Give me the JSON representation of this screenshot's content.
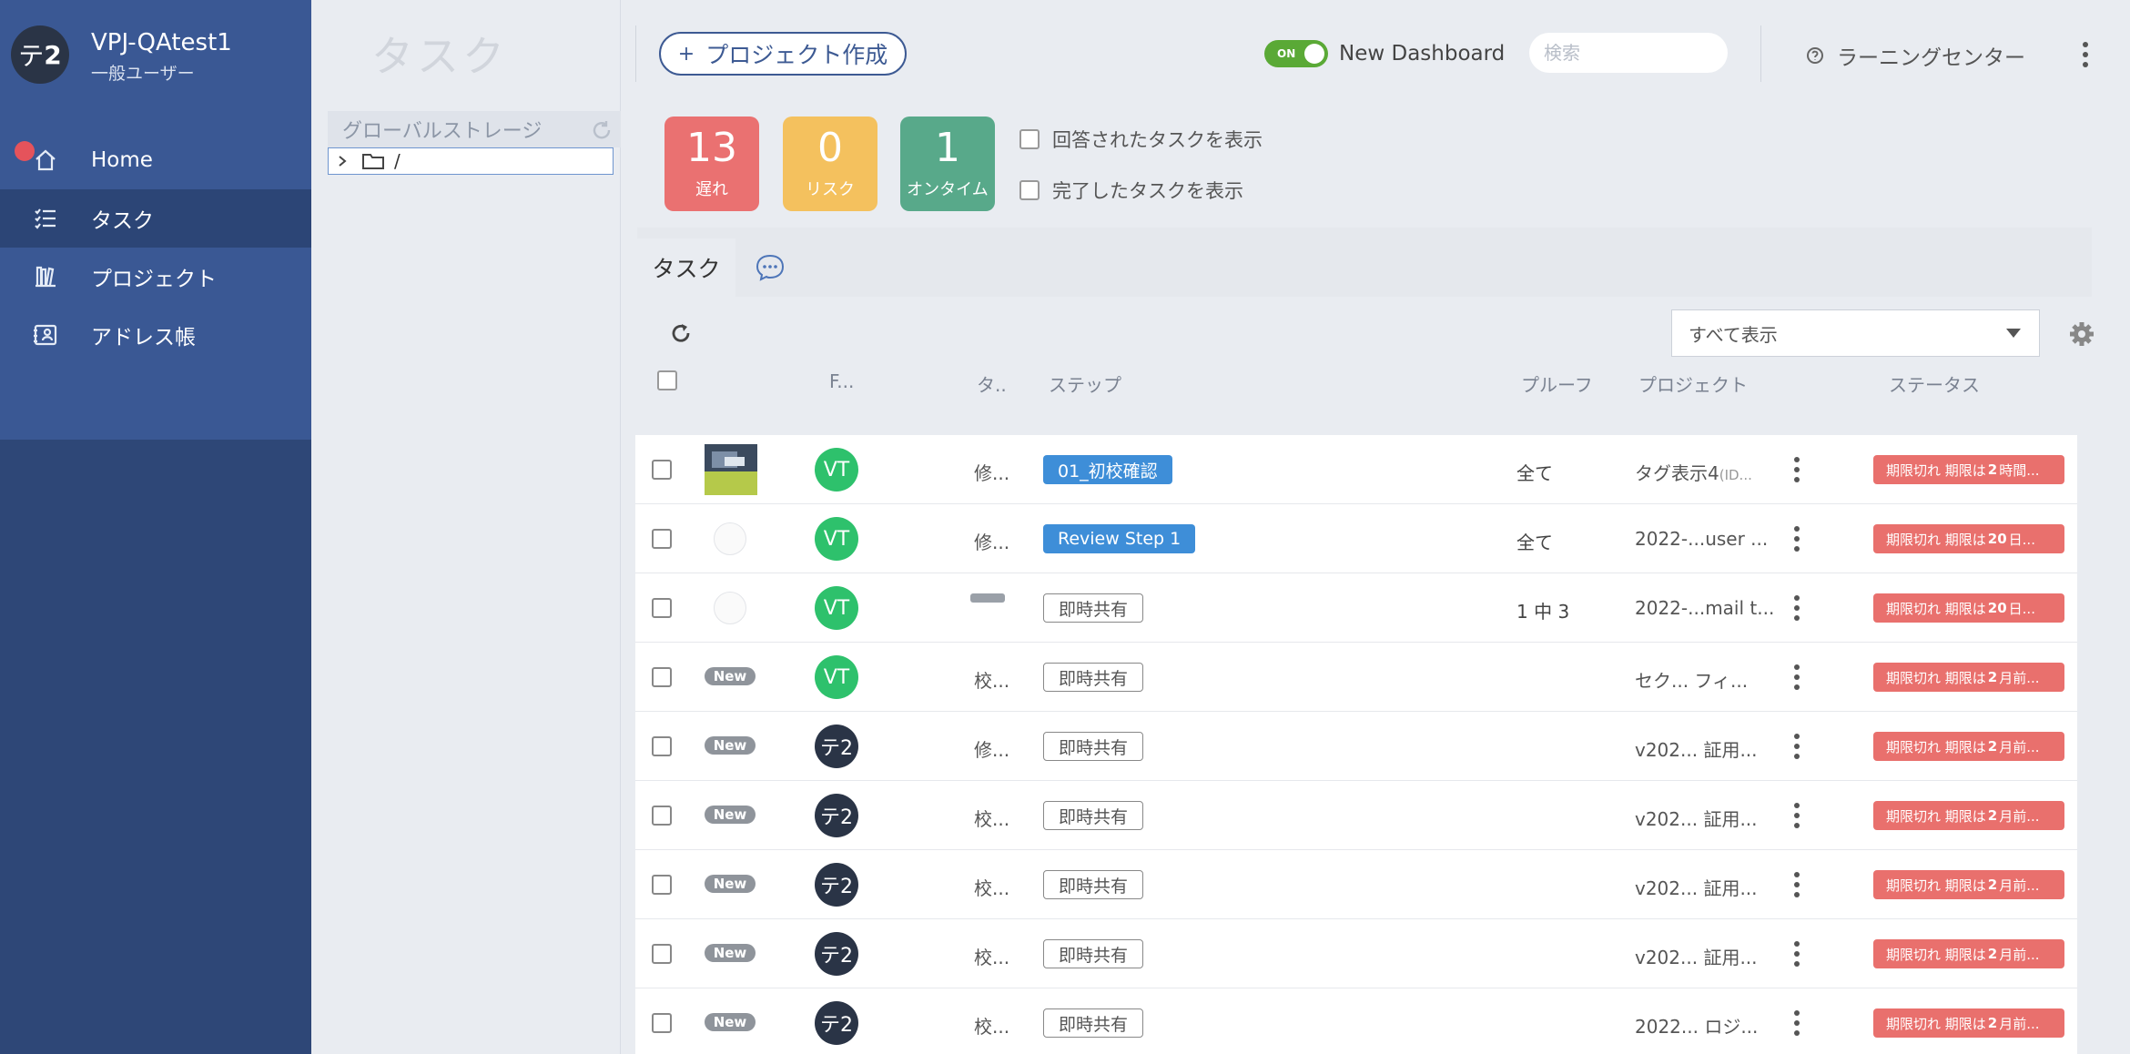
{
  "user": {
    "avatar_text": "テ",
    "avatar_num": "2",
    "name": "VPJ-QAtest1",
    "role": "一般ユーザー"
  },
  "nav": {
    "items": [
      {
        "label": "Home",
        "icon": "home-icon"
      },
      {
        "label": "タスク",
        "icon": "task-list-icon"
      },
      {
        "label": "プロジェクト",
        "icon": "books-icon"
      },
      {
        "label": "アドレス帳",
        "icon": "contact-card-icon"
      }
    ]
  },
  "page": {
    "title": "タスク"
  },
  "storage": {
    "title": "グローバルストレージ",
    "root": "/"
  },
  "header": {
    "create_project": "プロジェクト作成",
    "toggle_state": "ON",
    "dashboard_label": "New Dashboard",
    "search_placeholder": "検索",
    "learning_center": "ラーニングセンター"
  },
  "counts": {
    "late": {
      "value": "13",
      "label": "遅れ",
      "color": "#ea7171"
    },
    "risk": {
      "value": "0",
      "label": "リスク",
      "color": "#f4c15e"
    },
    "ontime": {
      "value": "1",
      "label": "オンタイム",
      "color": "#58a98a"
    }
  },
  "options": {
    "answered": "回答されたタスクを表示",
    "completed": "完了したタスクを表示"
  },
  "tabs": {
    "tasks": "タスク"
  },
  "filter": {
    "selected": "すべて表示"
  },
  "columns": {
    "f": "F...",
    "ta": "タ..",
    "step": "ステップ",
    "proof": "プルーフ",
    "project": "プロジェクト",
    "status": "ステータス"
  },
  "rows": [
    {
      "thumb": "image",
      "avatar": "VT",
      "avatar_color": "#2ec16c",
      "tcol": "修...",
      "step": "01_初校確認",
      "step_style": "blue",
      "proof": "全て",
      "project": "タグ表示4",
      "project_suffix": "(ID...",
      "status_pre": "期限切れ 期限は",
      "status_bold": "2",
      "status_post": "時間..."
    },
    {
      "thumb": "blank",
      "avatar": "VT",
      "avatar_color": "#2ec16c",
      "tcol": "修...",
      "step": "Review Step 1",
      "step_style": "blue",
      "proof": "全て",
      "project": "2022-...user ...",
      "project_suffix": "",
      "status_pre": "期限切れ 期限は",
      "status_bold": "20",
      "status_post": "日..."
    },
    {
      "thumb": "blank",
      "avatar": "VT",
      "avatar_color": "#2ec16c",
      "tcol": "",
      "tag_image": true,
      "step": "即時共有",
      "step_style": "outline",
      "proof": "1 中 3",
      "project": "2022-...mail t...",
      "project_suffix": "",
      "status_pre": "期限切れ 期限は",
      "status_bold": "20",
      "status_post": "日..."
    },
    {
      "thumb": "new",
      "avatar": "VT",
      "avatar_color": "#2ec16c",
      "tcol": "校...",
      "step": "即時共有",
      "step_style": "outline",
      "proof": "",
      "project": "セク...  フィ...",
      "project_suffix": "",
      "status_pre": "期限切れ 期限は",
      "status_bold": "2",
      "status_post": "月前..."
    },
    {
      "thumb": "new",
      "avatar": "テ2",
      "avatar_color": "#2a3446",
      "tcol": "修...",
      "step": "即時共有",
      "step_style": "outline",
      "proof": "",
      "project": "v202...  証用...",
      "project_suffix": "",
      "status_pre": "期限切れ 期限は",
      "status_bold": "2",
      "status_post": "月前..."
    },
    {
      "thumb": "new",
      "avatar": "テ2",
      "avatar_color": "#2a3446",
      "tcol": "校...",
      "step": "即時共有",
      "step_style": "outline",
      "proof": "",
      "project": "v202...  証用...",
      "project_suffix": "",
      "status_pre": "期限切れ 期限は",
      "status_bold": "2",
      "status_post": "月前..."
    },
    {
      "thumb": "new",
      "avatar": "テ2",
      "avatar_color": "#2a3446",
      "tcol": "校...",
      "step": "即時共有",
      "step_style": "outline",
      "proof": "",
      "project": "v202...  証用...",
      "project_suffix": "",
      "status_pre": "期限切れ 期限は",
      "status_bold": "2",
      "status_post": "月前..."
    },
    {
      "thumb": "new",
      "avatar": "テ2",
      "avatar_color": "#2a3446",
      "tcol": "校...",
      "step": "即時共有",
      "step_style": "outline",
      "proof": "",
      "project": "v202...  証用...",
      "project_suffix": "",
      "status_pre": "期限切れ 期限は",
      "status_bold": "2",
      "status_post": "月前..."
    },
    {
      "thumb": "new",
      "avatar": "テ2",
      "avatar_color": "#2a3446",
      "tcol": "校...",
      "step": "即時共有",
      "step_style": "outline",
      "proof": "",
      "project": "2022...  ロジ...",
      "project_suffix": "",
      "status_pre": "期限切れ 期限は",
      "status_bold": "2",
      "status_post": "月前..."
    }
  ],
  "new_badge": "New"
}
